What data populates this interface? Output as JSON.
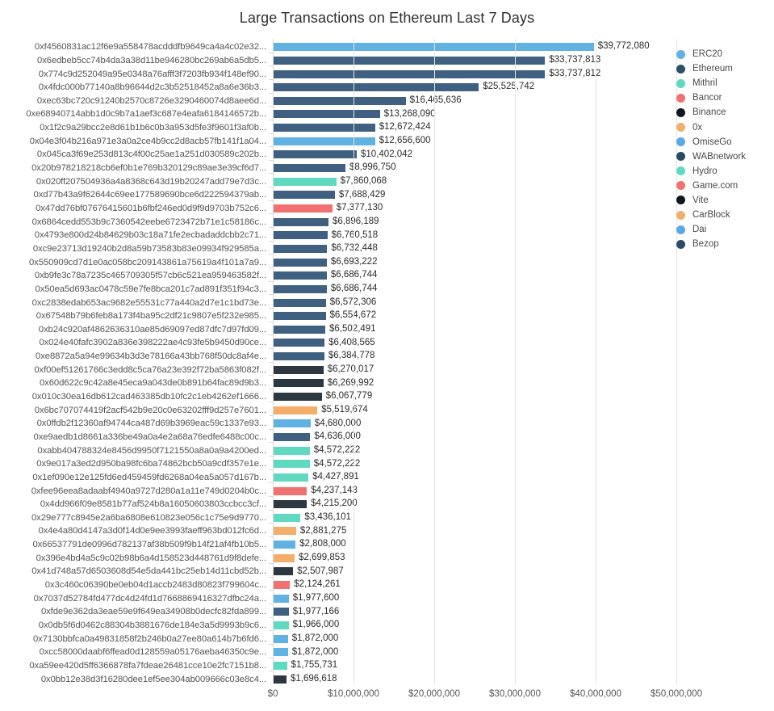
{
  "chart_data": {
    "type": "bar",
    "orientation": "horizontal",
    "title": "Large Transactions on Ethereum Last 7 Days",
    "xlabel": "",
    "ylabel": "",
    "xlim": [
      0,
      52000000
    ],
    "grid": true,
    "legend_position": "right",
    "xticks": [
      0,
      10000000,
      20000000,
      30000000,
      40000000,
      50000000
    ],
    "xtick_labels": [
      "$0",
      "$10,000,000",
      "$20,000,000",
      "$30,000,000",
      "$40,000,000",
      "$50,000,000"
    ],
    "categories": [
      "0xf4560831ac12f6e9a558478acdddfb9649ca4a4c02e32...",
      "0x6edbeb5cc74b4da3a38d11be946280bc269ab6a5db5...",
      "0x774c9d252049a95e0348a76afff3f7203fb934f148ef90...",
      "0x4fdc000b77140a8b96644d2c3b52518452a8a6e36b3...",
      "0xec63bc720c91240b2570c8726e3290460074d8aee6d...",
      "0xe68940714abb1d0c9b7a1aef3c687e4eafa6184146572b...",
      "0x1f2c9a29bcc2e8d61b1b6c0b3a953d5fe3f9601f3af0b...",
      "0x04e3f04b216a971e3a0a2ce4b9cc2d8acb57fb141f1a04...",
      "0x045ca3f69e253d813c4f00c25ae1a251d030589c202b...",
      "0x20b978218218cb6ef0b1e769b320129c89ae3e39cf6d7...",
      "0x020ff207504936a4a8368c643d19b20247add79e7d3c...",
      "0xd77b43a9f62644c69ee177589690bce6d222594379ab...",
      "0x47dd76bf07676415601b6fbf246ed0d9f9d9703b752c6...",
      "0x6864cedd553b9c7360542eebe6723472b71e1c58186c...",
      "0x4793e800d24b84629b03c18a71fe2ecbadaddcbb2c71...",
      "0xc9e23713d19240b2d8a59b73583b83e09934f929585a...",
      "0x550909cd7d1e0ac058bc209143861a75619a4f101a7a9...",
      "0xb9fe3c78a7235c465709305f57cb6c521ea959463582f...",
      "0x50ea5d693ac0478c59e7fe8bca201c7ad891f351f94c3...",
      "0xc2838edab653ac9682e55531c77a440a2d7e1c1bd73e...",
      "0x67548b79b6feb8a173f4ba95c2df21c9807e5f232e985...",
      "0xb24c920af4862636310ae85d69097ed87dfc7d97fd09...",
      "0x024e40fafc3902a836e398222ae4c93fe5b9450d90ce...",
      "0xe8872a5a94e99634b3d3e78166a43bb768f50dc8af4e...",
      "0xf00ef51261766c3edd8c5ca76a23e392f72ba5863f082f...",
      "0x60d622c9c42a8e45eca9a043de0b891b64fac89d9b3...",
      "0x010c30ea16db612cad463385db10fc2c1eb4262ef1666...",
      "0x6bc707074419f2acf542b9e20c0e63202fff9d257e7601...",
      "0x0ffdb2f12360af94744ca487d69b3969eac59c1337e93...",
      "0xe9aedb1d8661a336be49a0a4e2a68a76edfe6488c00c...",
      "0xabb404788324e8456d9950f7121550a8a0a9a4200ed...",
      "0x9e017a3ed2d950ba98fc6ba74862bcb50a9cdf357e1e...",
      "0x1ef090e12e125fd6ed459459fd6268a04ea5a057d167b...",
      "0xfee96eea8adaabf4940a9727d280a1a11e749d0204b0c...",
      "0x4dd966f09e8581b77af524b8a16050603803ccbcc3cf...",
      "0x29e777c8945e2a6ba6808e610823e056c1c75e9d9770...",
      "0x4e4a80d4147a3d0f14d0e9ee3993faeff963bd012fc6d...",
      "0x66537791de0996d782137af38b509f9b14f21af4fb10b5...",
      "0x396e4bd4a5c9c02b98b6a4d158523d448761d9f8defe...",
      "0x41d748a57d6503608d54e5da441bc25eb14d11cbd52b...",
      "0x3c460c06390be0eb04d1accb2483d80823f799604c...",
      "0x7037d52784fd477dc4d24fd1d7668869416327dfbc24a...",
      "0xfde9e362da3eae59e9f649ea34908b0decfc82fda899...",
      "0x0db5f6d0462c88304b3881676de184e3a5d9993b9c6...",
      "0x7130bbfca0a49831858f2b246b0a27ee80a614b7b6fd6...",
      "0xcc58000daabf6ffead0d128559a05176aeba46350c9e...",
      "0xa59ee420d5ff6366878fa7fdeae26481cce10e2fc7151b8...",
      "0x0bb12e38d3f16280dee1ef5ee304ab009666c03e8c4..."
    ],
    "values": [
      39772080,
      33737813,
      33737812,
      25525742,
      16465636,
      13268090,
      12672424,
      12656600,
      10402042,
      8996750,
      7860068,
      7688429,
      7377130,
      6896189,
      6760518,
      6732448,
      6693222,
      6686744,
      6686744,
      6572306,
      6554672,
      6502491,
      6408565,
      6384778,
      6270017,
      6269992,
      6067779,
      5519674,
      4680000,
      4636000,
      4572222,
      4572222,
      4427891,
      4237143,
      4215200,
      3436101,
      2881275,
      2808000,
      2699853,
      2507987,
      2124261,
      1977600,
      1977166,
      1966000,
      1872000,
      1872000,
      1755731,
      1696618
    ],
    "value_labels": [
      "$39,772,080",
      "$33,737,813",
      "$33,737,812",
      "$25,525,742",
      "$16,465,636",
      "$13,268,090",
      "$12,672,424",
      "$12,656,600",
      "$10,402,042",
      "$8,996,750",
      "$7,860,068",
      "$7,688,429",
      "$7,377,130",
      "$6,896,189",
      "$6,760,518",
      "$6,732,448",
      "$6,693,222",
      "$6,686,744",
      "$6,686,744",
      "$6,572,306",
      "$6,554,672",
      "$6,502,491",
      "$6,408,565",
      "$6,384,778",
      "$6,270,017",
      "$6,269,992",
      "$6,067,779",
      "$5,519,674",
      "$4,680,000",
      "$4,636,000",
      "$4,572,222",
      "$4,572,222",
      "$4,427,891",
      "$4,237,143",
      "$4,215,200",
      "$3,436,101",
      "$2,881,275",
      "$2,808,000",
      "$2,699,853",
      "$2,507,987",
      "$2,124,261",
      "$1,977,600",
      "$1,977,166",
      "$1,966,000",
      "$1,872,000",
      "$1,872,000",
      "$1,755,731",
      "$1,696,618"
    ],
    "bar_colors": [
      "#5fb2e2",
      "#3f6080",
      "#3f6080",
      "#3f6080",
      "#3f6080",
      "#3f6080",
      "#3f6080",
      "#5fb2e2",
      "#3f6080",
      "#3f6080",
      "#5fd9c0",
      "#3f6080",
      "#f0716f",
      "#3f6080",
      "#3f6080",
      "#3f6080",
      "#3f6080",
      "#3f6080",
      "#3f6080",
      "#3f6080",
      "#3f6080",
      "#3f6080",
      "#3f6080",
      "#3f6080",
      "#2d3740",
      "#2d3740",
      "#2d3740",
      "#f2ae6a",
      "#5fb2e2",
      "#3f6080",
      "#5fd9c0",
      "#5fd9c0",
      "#5fd9c0",
      "#f0716f",
      "#2d3740",
      "#5fd9c0",
      "#f2ae6a",
      "#5fb2e2",
      "#f2ae6a",
      "#2d3740",
      "#f0716f",
      "#5fb2e2",
      "#3f6080",
      "#5fd9c0",
      "#5fb2e2",
      "#5fb2e2",
      "#5fd9c0",
      "#2d3740"
    ],
    "legend": [
      {
        "label": "ERC20",
        "color": "#5fb2e2"
      },
      {
        "label": "Ethereum",
        "color": "#2f5068"
      },
      {
        "label": "Mithril",
        "color": "#5fd9c0"
      },
      {
        "label": "Bancor",
        "color": "#f0716f"
      },
      {
        "label": "Binance",
        "color": "#10161f"
      },
      {
        "label": "0x",
        "color": "#f2ae6a"
      },
      {
        "label": "OmiseGo",
        "color": "#5aa8e8"
      },
      {
        "label": "WABnetwork",
        "color": "#2b4a63"
      },
      {
        "label": "Hydro",
        "color": "#5fd9c0"
      },
      {
        "label": "Game.com",
        "color": "#f0716f"
      },
      {
        "label": "Vite",
        "color": "#10161f"
      },
      {
        "label": "CarBlock",
        "color": "#f2ae6a"
      },
      {
        "label": "Dai",
        "color": "#5aa8e8"
      },
      {
        "label": "Bezop",
        "color": "#2b4a63"
      }
    ]
  }
}
